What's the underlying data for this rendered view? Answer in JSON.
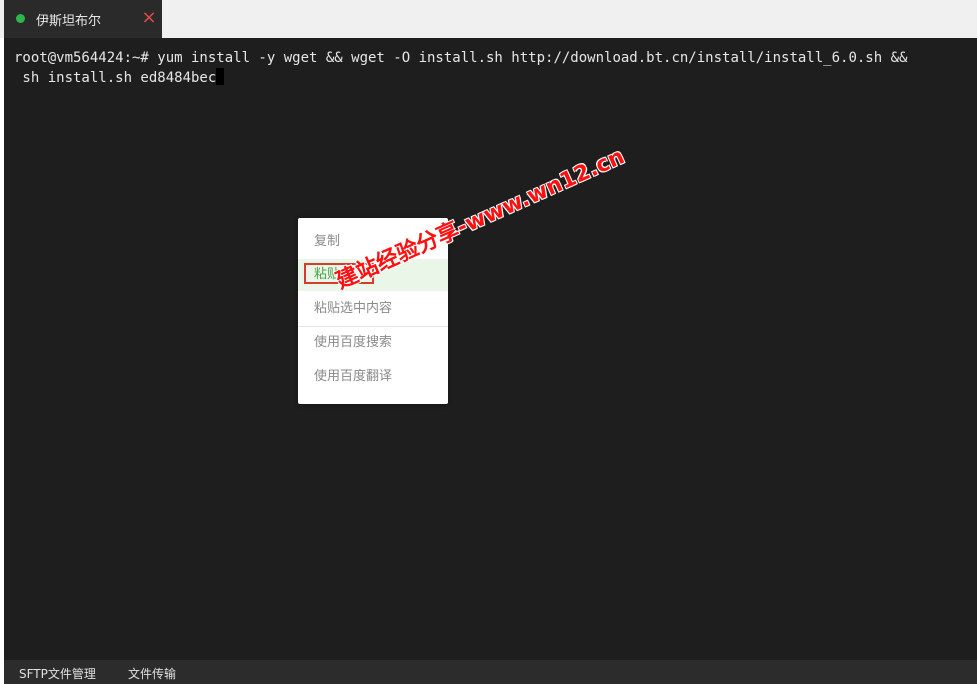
{
  "tab": {
    "title": "伊斯坦布尔",
    "close_icon": "×",
    "status_color": "#2fb54a"
  },
  "terminal": {
    "line1": "root@vm564424:~# yum install -y wget && wget -O install.sh http://download.bt.cn/install/install_6.0.sh &&",
    "line2": " sh install.sh ed8484bec"
  },
  "context_menu": {
    "items": [
      "复制",
      "粘贴",
      "粘贴选中内容",
      "使用百度搜索",
      "使用百度翻译"
    ],
    "active_index": 1
  },
  "watermark": "建站经验分享-www.wn12.cn",
  "statusbar": {
    "sftp": "SFTP文件管理",
    "transfer": "文件传输"
  }
}
